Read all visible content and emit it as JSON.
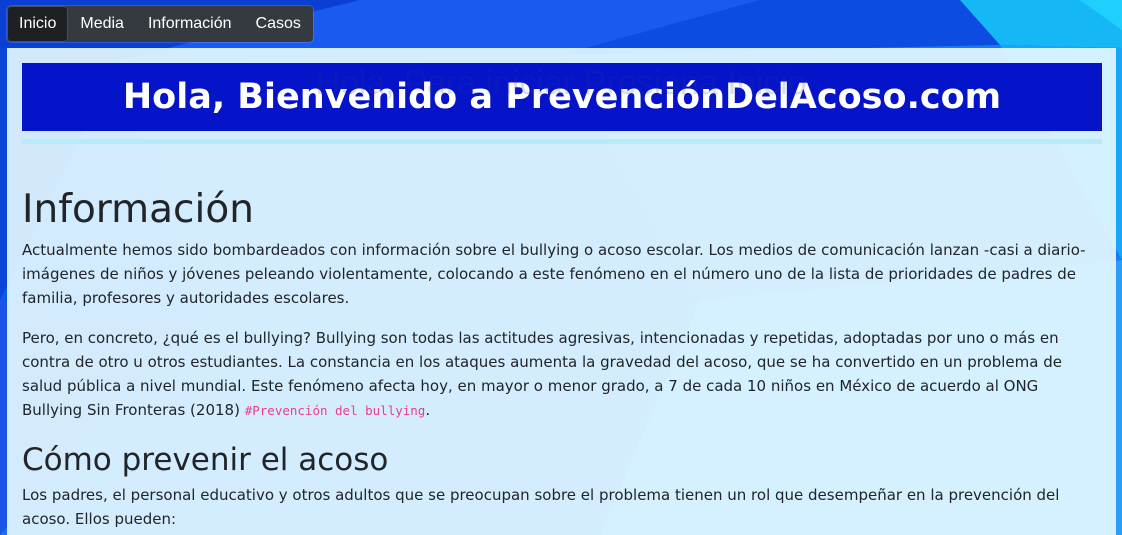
{
  "nav": {
    "items": [
      {
        "label": "Inicio",
        "active": true
      },
      {
        "label": "Media",
        "active": false
      },
      {
        "label": "Información",
        "active": false
      },
      {
        "label": "Casos",
        "active": false
      }
    ]
  },
  "banner": {
    "ghost_text": "Hola, Para iniciar Presiona Inicio",
    "title": "Hola, Bienvenido a PrevenciónDelAcoso.com",
    "bg_color": "#0513c9"
  },
  "info": {
    "heading": "Información",
    "paragraph1": "Actualmente hemos sido bombardeados con información sobre el bullying o acoso escolar. Los medios de comunicación lanzan -casi a diario- imágenes de niños y jóvenes peleando violentamente, colocando a este fenómeno en el número uno de la lista de prioridades de padres de familia, profesores y autoridades escolares.",
    "paragraph2": "Pero, en concreto, ¿qué es el bullying? Bullying son todas las actitudes agresivas, intencionadas y repetidas, adoptadas por uno o más en contra de otro u otros estudiantes. La constancia en los ataques aumenta la gravedad del acoso, que se ha convertido en un problema de salud pública a nivel mundial. Este fenómeno afecta hoy, en mayor o menor grado, a 7 de cada 10 niños en México de acuerdo al ONG Bullying Sin Fronteras (2018)",
    "hashtag": "#Prevención del bullying",
    "end_punct": "."
  },
  "prevent": {
    "heading": "Cómo prevenir el acoso",
    "paragraph1": "Los padres, el personal educativo y otros adultos que se preocupan sobre el problema tienen un rol que desempeñar en la prevención del acoso. Ellos pueden:"
  }
}
